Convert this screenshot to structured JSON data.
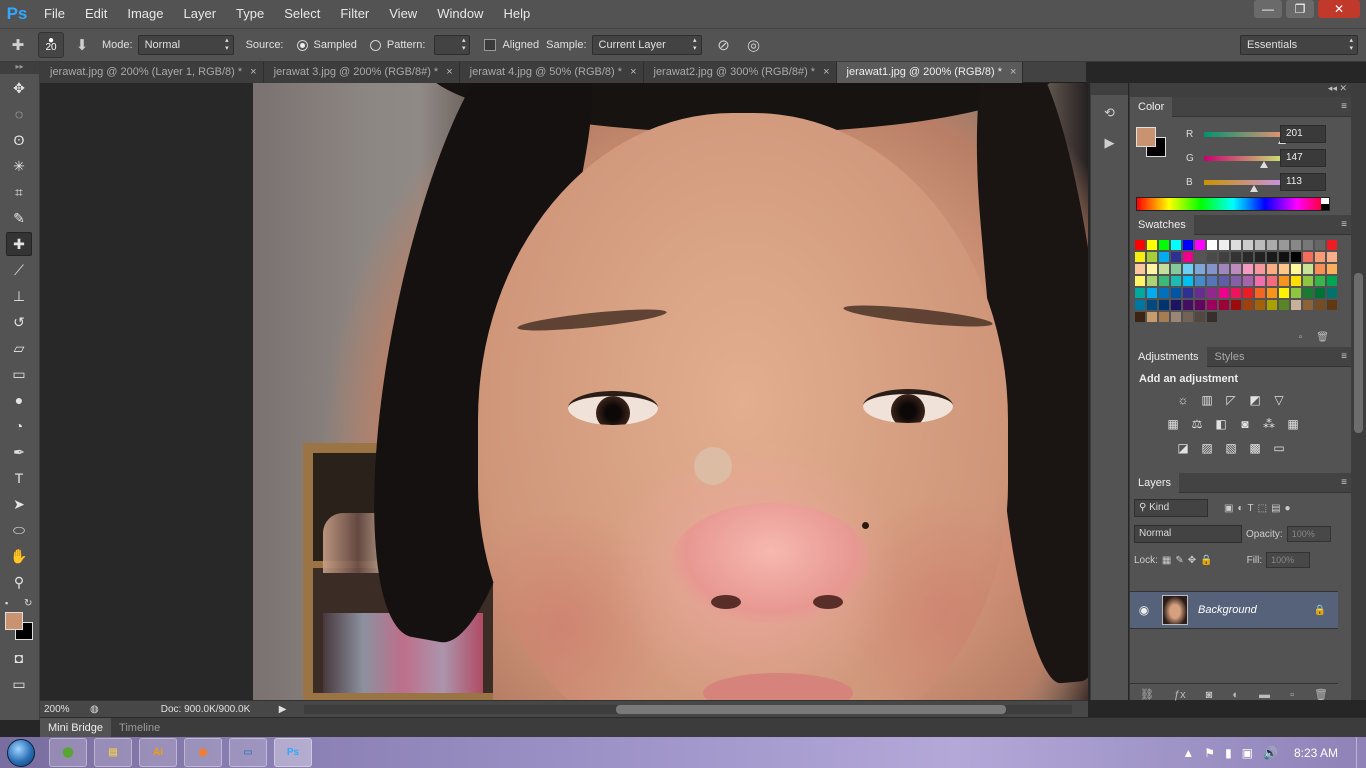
{
  "app": {
    "logo": "Ps"
  },
  "menu": [
    "File",
    "Edit",
    "Image",
    "Layer",
    "Type",
    "Select",
    "Filter",
    "View",
    "Window",
    "Help"
  ],
  "window_controls": {
    "minimize": "—",
    "restore": "❐",
    "close": "✕"
  },
  "options": {
    "brush_size": "20",
    "mode_label": "Mode:",
    "mode_value": "Normal",
    "source_label": "Source:",
    "sampled_label": "Sampled",
    "pattern_label": "Pattern:",
    "aligned_label": "Aligned",
    "sample_label": "Sample:",
    "sample_value": "Current Layer",
    "workspace": "Essentials"
  },
  "tabs": [
    {
      "label": "jerawat.jpg @ 200% (Layer 1, RGB/8) *",
      "active": false
    },
    {
      "label": "jerawat 3.jpg @ 200% (RGB/8#) *",
      "active": false
    },
    {
      "label": "jerawat 4.jpg @ 50% (RGB/8) *",
      "active": false
    },
    {
      "label": "jerawat2.jpg @ 300% (RGB/8#) *",
      "active": false
    },
    {
      "label": "jerawat1.jpg @ 200% (RGB/8) *",
      "active": true
    }
  ],
  "tab_close": "×",
  "tools": [
    {
      "name": "move-tool",
      "glyph": "✥"
    },
    {
      "name": "marquee-tool",
      "glyph": "◌"
    },
    {
      "name": "lasso-tool",
      "glyph": "ʘ"
    },
    {
      "name": "magic-wand-tool",
      "glyph": "✳"
    },
    {
      "name": "crop-tool",
      "glyph": "⌗"
    },
    {
      "name": "eyedropper-tool",
      "glyph": "✎"
    },
    {
      "name": "healing-brush-tool",
      "glyph": "✚",
      "active": true
    },
    {
      "name": "brush-tool",
      "glyph": "⟋"
    },
    {
      "name": "clone-stamp-tool",
      "glyph": "⊥"
    },
    {
      "name": "history-brush-tool",
      "glyph": "↺"
    },
    {
      "name": "eraser-tool",
      "glyph": "▱"
    },
    {
      "name": "gradient-tool",
      "glyph": "▭"
    },
    {
      "name": "blur-tool",
      "glyph": "●"
    },
    {
      "name": "dodge-tool",
      "glyph": "◔"
    },
    {
      "name": "pen-tool",
      "glyph": "✒"
    },
    {
      "name": "type-tool",
      "glyph": "T"
    },
    {
      "name": "path-selection-tool",
      "glyph": "➤"
    },
    {
      "name": "ellipse-tool",
      "glyph": "⬭"
    },
    {
      "name": "hand-tool",
      "glyph": "✋"
    },
    {
      "name": "zoom-tool",
      "glyph": "⚲"
    }
  ],
  "colors": {
    "foreground": "#c99371",
    "background": "#000000"
  },
  "status": {
    "zoom": "200%",
    "doc": "Doc: 900.0K/900.0K"
  },
  "bottom_tabs": [
    {
      "label": "Mini Bridge",
      "active": true
    },
    {
      "label": "Timeline",
      "active": false
    }
  ],
  "color_panel": {
    "title": "Color",
    "r_label": "R",
    "r_value": "201",
    "g_label": "G",
    "g_value": "147",
    "b_label": "B",
    "b_value": "113"
  },
  "swatches_panel": {
    "title": "Swatches",
    "colors": [
      "#ff0000",
      "#ffff00",
      "#00ff00",
      "#00ffff",
      "#0000ff",
      "#ff00ff",
      "#ffffff",
      "#eeeeee",
      "#dddddd",
      "#cccccc",
      "#bbbbbb",
      "#aaaaaa",
      "#999999",
      "#888888",
      "#777777",
      "#666666",
      "#ee1d24",
      "#f7ec13",
      "#a4cf38",
      "#00aeef",
      "#2e3192",
      "#ec008c",
      "#555555",
      "#4a4a4a",
      "#404040",
      "#333333",
      "#2a2a2a",
      "#222222",
      "#1a1a1a",
      "#111111",
      "#000000",
      "#f26d5b",
      "#f79b77",
      "#f9ae8a",
      "#fbc89e",
      "#fff4a3",
      "#c4df9b",
      "#82ca9c",
      "#6ccff6",
      "#7da7d8",
      "#8493ca",
      "#a186be",
      "#bd8cbf",
      "#f49ac1",
      "#f6989d",
      "#f9ad81",
      "#fdc68a",
      "#fff799",
      "#c9e394",
      "#f68e55",
      "#fbaf5d",
      "#fff467",
      "#acd373",
      "#3cb878",
      "#1cbbb4",
      "#00bff3",
      "#438ccb",
      "#5574b9",
      "#605ca8",
      "#855fa8",
      "#a763a9",
      "#f06ea9",
      "#f26c7c",
      "#f7941d",
      "#ffde00",
      "#8dc63f",
      "#39b54a",
      "#00a651",
      "#00a99d",
      "#00aeef",
      "#0072bc",
      "#0054a6",
      "#2e3192",
      "#662d91",
      "#92278f",
      "#ec008c",
      "#ed145b",
      "#ed1c24",
      "#f26522",
      "#f7941d",
      "#fff200",
      "#8dc73f",
      "#197b30",
      "#007236",
      "#00746b",
      "#0076a3",
      "#004a80",
      "#003471",
      "#1b1464",
      "#440e62",
      "#630460",
      "#9e005d",
      "#9e0039",
      "#9e0b0f",
      "#a0410d",
      "#a36209",
      "#aba000",
      "#598527",
      "#c7b299",
      "#8c6239",
      "#754c24",
      "#603913",
      "#3c2415",
      "#c69c6d",
      "#a67c52",
      "#998675",
      "#736357",
      "#534741",
      "#362f2d"
    ]
  },
  "adjustments_panel": {
    "tab_adjustments": "Adjustments",
    "tab_styles": "Styles",
    "heading": "Add an adjustment"
  },
  "layers_panel": {
    "title": "Layers",
    "kind": "Kind",
    "blend": "Normal",
    "opacity_label": "Opacity:",
    "opacity_value": "100%",
    "lock_label": "Lock:",
    "fill_label": "Fill:",
    "fill_value": "100%",
    "layer_name": "Background"
  },
  "taskbar": {
    "apps": [
      {
        "name": "app-green",
        "label": "⬤",
        "color": "#5aa531"
      },
      {
        "name": "file-explorer",
        "label": "▤",
        "color": "#e8c35a"
      },
      {
        "name": "illustrator",
        "label": "Ai",
        "color": "#ff9a00"
      },
      {
        "name": "firefox",
        "label": "◉",
        "color": "#ff7a1a"
      },
      {
        "name": "window-app",
        "label": "▭",
        "color": "#4a7fb8"
      },
      {
        "name": "photoshop",
        "label": "Ps",
        "color": "#31a8ff"
      }
    ],
    "time": "8:23 AM"
  }
}
